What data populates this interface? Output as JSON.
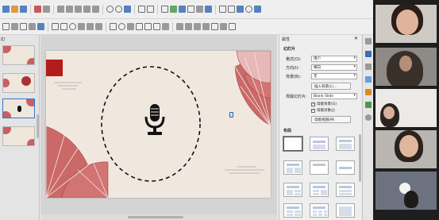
{
  "toolbar": {
    "row1_icons": [
      "new-icon",
      "open-icon",
      "save-icon",
      "export-pdf-icon",
      "print-icon",
      "cut-icon",
      "copy-icon",
      "paste-icon",
      "clone-icon",
      "undo-icon",
      "redo-icon",
      "spelling-icon",
      "grid-icon",
      "display-views-icon",
      "table-icon",
      "image-icon",
      "chart-icon",
      "textbox-icon",
      "special-char-icon",
      "fontwork-icon",
      "shapes-icon",
      "slide-icon",
      "start-slideshow-icon",
      "present-icon"
    ],
    "row2_icons": [
      "select-icon",
      "zoom-icon",
      "textbox-icon",
      "line-color-icon",
      "fill-color-icon",
      "line-icon",
      "rectangle-icon",
      "ellipse-icon",
      "arrow-icon",
      "curve-icon",
      "connector-icon",
      "basic-shapes-icon",
      "symbol-shapes-icon",
      "block-arrows-icon",
      "flowchart-icon",
      "callouts-icon",
      "stars-icon",
      "3d-icon",
      "rotate-icon",
      "align-icon",
      "arrange-icon",
      "shadow-icon",
      "crop-icon",
      "filter-icon",
      "toggle-extrusion-icon"
    ]
  },
  "slides_panel": {
    "title": "幻"
  },
  "properties": {
    "title": "属性",
    "slide_section": "幻灯片",
    "format_label": "格式(O):",
    "format_value": "用户",
    "orientation_label": "方向(I):",
    "orientation_value": "横向",
    "background_label": "背景(B):",
    "background_value": "无",
    "insert_image_button": "插入背景(L)...",
    "master_label": "母版幻灯片:",
    "master_value": "Blank Slide",
    "show_master_bg": "母版背景(G)",
    "show_master_objects": "母版对象(J)",
    "master_view_button": "母版视图(M)",
    "layouts_section": "布局"
  },
  "colors": {
    "accent_red": "#b41c1c",
    "slide_bg": "#f0e8df",
    "fan_red": "#c86060"
  }
}
